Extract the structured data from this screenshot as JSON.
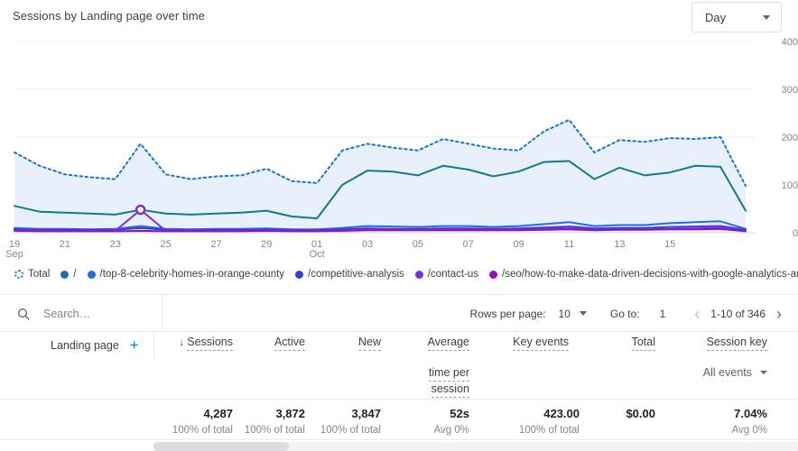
{
  "header": {
    "title": "Sessions by Landing page over time",
    "granularity_value": "Day",
    "granularity_icon": "chevron-down-icon"
  },
  "legend": {
    "items": [
      {
        "label": "Total",
        "color": "#1a73c8",
        "style": "dotted"
      },
      {
        "label": "/",
        "color": "#1a73a8",
        "style": "solid"
      },
      {
        "label": "/top-8-celebrity-homes-in-orange-county",
        "color": "#1f6fe0",
        "style": "solid"
      },
      {
        "label": "/competitive-analysis",
        "color": "#3b3bdb",
        "style": "solid"
      },
      {
        "label": "/contact-us",
        "color": "#7b2fd4",
        "style": "solid"
      },
      {
        "label": "/seo/how-to-make-data-driven-decisions-with-google-analytics-and-search-console",
        "color": "#9113b8",
        "style": "solid"
      }
    ]
  },
  "toolbar": {
    "search_placeholder": "Search…",
    "search_value": "",
    "search_icon": "search-icon",
    "rows_per_page_label": "Rows per page:",
    "rows_per_page_value": "10",
    "goto_label": "Go to:",
    "goto_value": "1",
    "range_text": "1-10 of 346",
    "prev_icon": "chevron-left-icon",
    "next_icon": "chevron-right-icon"
  },
  "table": {
    "dimension_header": "Landing page",
    "add_dimension_icon": "plus-icon",
    "sort_icon": "arrow-down-icon",
    "columns": [
      {
        "label": "Sessions",
        "sorted": true
      },
      {
        "label": "Active",
        "sorted": false
      },
      {
        "label": "New",
        "sorted": false
      },
      {
        "label": "Average",
        "label2": "time per",
        "label3": "session",
        "sorted": false
      },
      {
        "label": "Key events",
        "sorted": false
      },
      {
        "label": "Total",
        "sorted": false
      },
      {
        "label": "Session key",
        "sorted": false
      }
    ],
    "key_events_filter": "All events",
    "key_events_filter_icon": "chevron-down-icon",
    "totals": [
      {
        "value": "4,287",
        "sub": "100% of total"
      },
      {
        "value": "3,872",
        "sub": "100% of total"
      },
      {
        "value": "3,847",
        "sub": "100% of total"
      },
      {
        "value": "52s",
        "sub": "Avg 0%"
      },
      {
        "value": "423.00",
        "sub": "100% of total"
      },
      {
        "value": "$0.00",
        "sub": ""
      },
      {
        "value": "7.04%",
        "sub": "Avg 0%"
      }
    ]
  },
  "chart_data": {
    "type": "area",
    "title": "Sessions by Landing page over time",
    "xlabel": "",
    "ylabel": "",
    "ylim": [
      0,
      400
    ],
    "yticks": [
      0,
      100,
      200,
      300,
      400
    ],
    "grid": true,
    "legend_position": "bottom",
    "x": [
      "19 Sep",
      "20",
      "21",
      "22",
      "23",
      "24",
      "25",
      "26",
      "27",
      "28",
      "29",
      "30",
      "01 Oct",
      "02",
      "03",
      "04",
      "05",
      "06",
      "07",
      "08",
      "09",
      "10",
      "11",
      "12",
      "13",
      "14",
      "15",
      "16"
    ],
    "xticks": [
      "19\nSep",
      "21",
      "23",
      "25",
      "27",
      "29",
      "01\nOct",
      "03",
      "05",
      "07",
      "09",
      "11",
      "13",
      "15"
    ],
    "series": [
      {
        "name": "Total",
        "color": "#1a73c8",
        "style": "dotted",
        "fill": "#e8f0fb",
        "values": [
          168,
          140,
          122,
          116,
          112,
          186,
          122,
          112,
          118,
          120,
          134,
          108,
          104,
          172,
          186,
          178,
          172,
          196,
          186,
          176,
          172,
          212,
          236,
          168,
          194,
          190,
          198,
          196,
          200,
          98
        ]
      },
      {
        "name": "/",
        "color": "#12798f",
        "style": "solid",
        "values": [
          56,
          44,
          42,
          40,
          38,
          48,
          40,
          38,
          40,
          42,
          46,
          34,
          30,
          100,
          130,
          128,
          120,
          140,
          132,
          118,
          128,
          148,
          150,
          112,
          136,
          120,
          126,
          140,
          138,
          46
        ]
      },
      {
        "name": "/top-8-celebrity-homes-in-orange-county",
        "color": "#1f6fe0",
        "style": "solid",
        "values": [
          10,
          8,
          8,
          7,
          8,
          14,
          8,
          7,
          8,
          8,
          9,
          7,
          7,
          10,
          14,
          13,
          12,
          14,
          14,
          12,
          14,
          18,
          22,
          14,
          16,
          16,
          20,
          22,
          24,
          8
        ]
      },
      {
        "name": "/competitive-analysis",
        "color": "#3b3bdb",
        "style": "solid",
        "values": [
          7,
          6,
          6,
          6,
          6,
          10,
          6,
          5,
          6,
          6,
          7,
          5,
          5,
          7,
          9,
          8,
          8,
          9,
          9,
          8,
          9,
          11,
          13,
          9,
          10,
          10,
          12,
          13,
          14,
          6
        ]
      },
      {
        "name": "/contact-us",
        "color": "#7b2fd4",
        "style": "solid",
        "values": [
          5,
          4,
          4,
          4,
          4,
          48,
          4,
          4,
          4,
          4,
          5,
          4,
          4,
          5,
          6,
          6,
          6,
          6,
          6,
          6,
          6,
          8,
          9,
          6,
          7,
          7,
          8,
          9,
          10,
          4
        ]
      },
      {
        "name": "/seo/how-to-make-data-driven-decisions-with-google-analytics-and-search-console",
        "color": "#9113b8",
        "style": "solid",
        "values": [
          4,
          3,
          3,
          3,
          3,
          4,
          3,
          3,
          3,
          3,
          4,
          3,
          3,
          4,
          5,
          5,
          5,
          5,
          5,
          5,
          5,
          6,
          7,
          5,
          6,
          6,
          7,
          7,
          8,
          3
        ]
      }
    ],
    "highlight_point": {
      "series": "/contact-us",
      "x_index": 5,
      "value": 48
    }
  }
}
